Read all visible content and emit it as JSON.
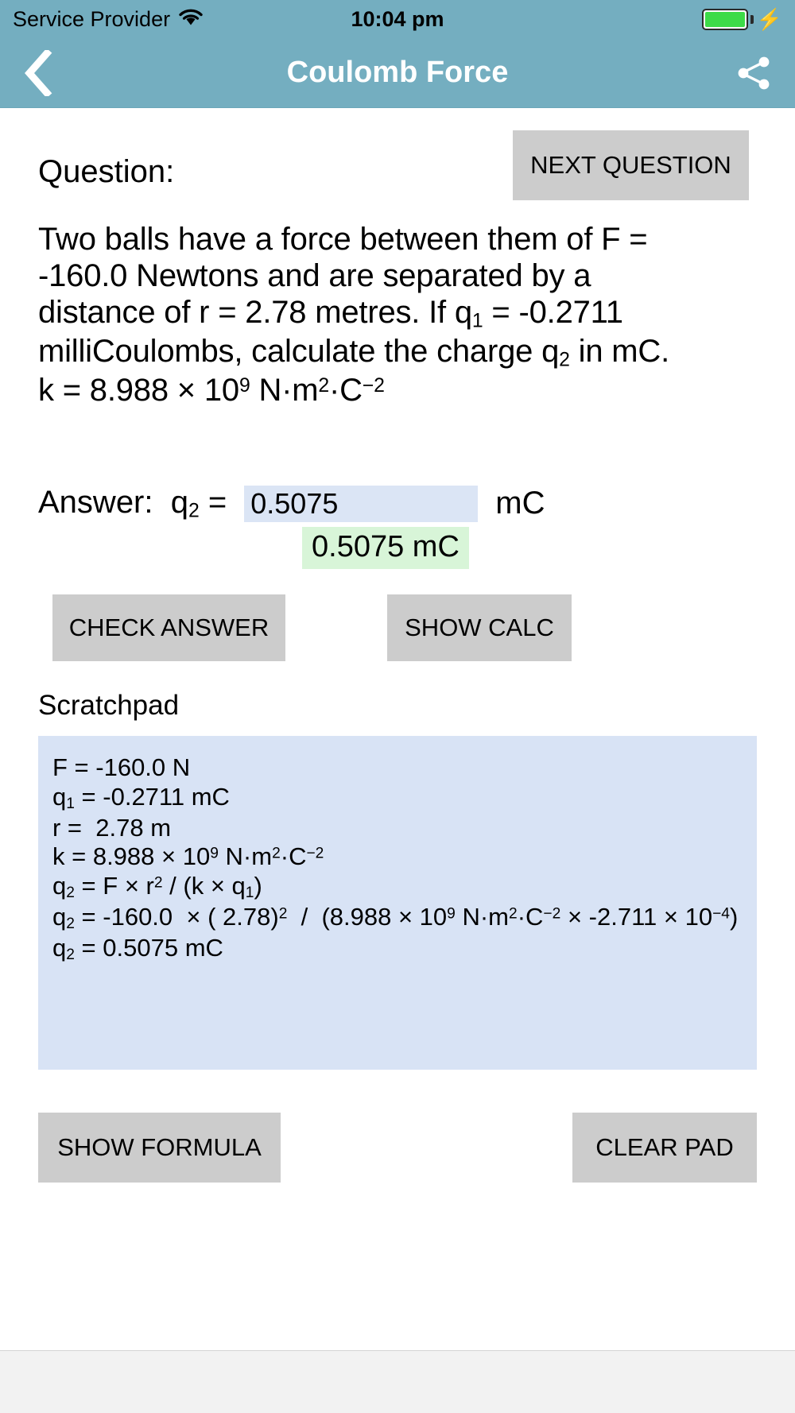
{
  "status_bar": {
    "carrier": "Service Provider",
    "time": "10:04 pm",
    "wifi_icon": "wifi-icon",
    "battery_icon": "battery-icon",
    "charging_icon": "lightning-bolt-icon",
    "battery_color": "#3ddb48"
  },
  "nav_bar": {
    "back_icon": "chevron-left-icon",
    "title": "Coulomb Force",
    "share_icon": "share-icon",
    "background_color": "#74aec0",
    "title_color": "#ffffff"
  },
  "question": {
    "label": "Question:",
    "next_button": "NEXT QUESTION",
    "line1": "Two balls have a force between them of F =",
    "line2": "-160.0 Newtons  and  are separated by a",
    "line3_a": "distance of r = 2.78 metres. If q",
    "line3_sub": "1",
    "line3_b": " = -0.2711",
    "line4_a": "milliCoulombs, calculate the  charge q",
    "line4_sub": "2",
    "line4_b": " in mC.",
    "line5_a": "k = 8.988 × 10",
    "line5_sup": "9",
    "line5_b": " N·m",
    "line5_sup2": "2",
    "line5_c": "·C",
    "line5_sup3": "−2"
  },
  "answer": {
    "label_prefix": "Answer:  q",
    "label_sub": "2",
    "label_suffix": " =",
    "value": "0.5075",
    "placeholder": "",
    "unit": "mC",
    "result": "0.5075 mC",
    "input_background": "#dbe5f5",
    "result_background": "#d8f5d8",
    "check_button": "CHECK ANSWER",
    "show_calc_button": "SHOW CALC"
  },
  "scratchpad": {
    "label": "Scratchpad",
    "background": "#d8e3f5",
    "lines": [
      {
        "id": "F",
        "html": "F = -160.0 N"
      },
      {
        "id": "q1",
        "html": "q<sub>1</sub> = -0.2711 mC"
      },
      {
        "id": "r",
        "html": "r =  2.78 m"
      },
      {
        "id": "k",
        "html": "k = 8.988 × 10<sup>9</sup> N·m<sup>2</sup>·C<sup>−2</sup>"
      },
      {
        "id": "formula",
        "html": "q<sub>2</sub> = F × r<sup>2</sup> / (k × q<sub>1</sub>)"
      },
      {
        "id": "substitution",
        "html": "q<sub>2</sub> = -160.0  × ( 2.78)<sup>2</sup>  /  (8.988 × 10<sup>9</sup> N·m<sup>2</sup>·C<sup>−2</sup> × -2.711 × 10<sup>−4</sup>)"
      },
      {
        "id": "result",
        "html": "q<sub>2</sub> = 0.5075 mC"
      }
    ],
    "plain_text": "F = -160.0 N\nq1 = -0.2711 mC\nr =  2.78 m\nk = 8.988 × 10⁹ N·m²·C⁻²\nq2 = F × r² / (k × q1)\nq2 = -160.0  × ( 2.78)²  /  (8.988 × 10⁹ N·m²·C⁻² × -2.711 × 10⁻⁴)\nq2 = 0.5075 mC"
  },
  "bottom_actions": {
    "show_formula": "SHOW FORMULA",
    "clear_pad": "CLEAR PAD"
  }
}
